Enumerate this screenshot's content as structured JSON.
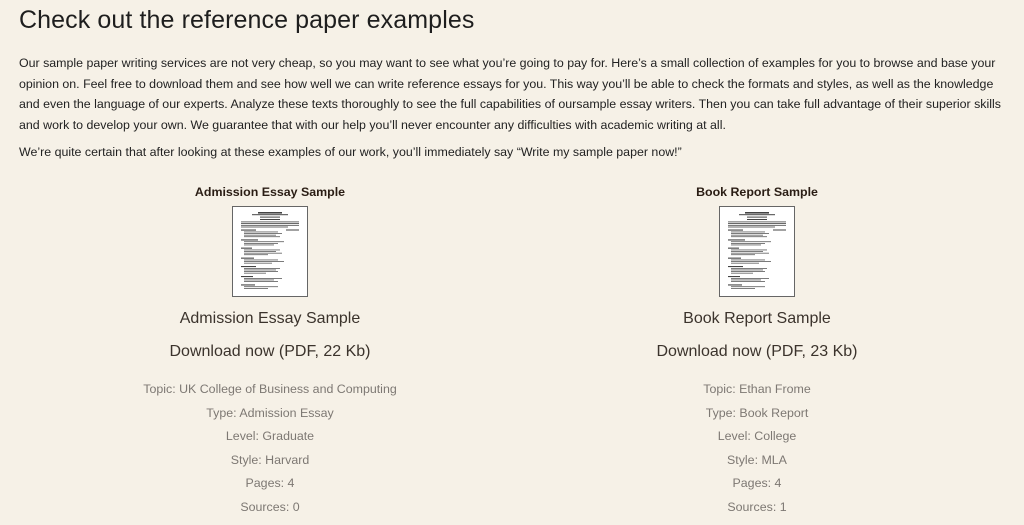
{
  "page": {
    "title": "Check out the reference paper examples",
    "intro": "Our sample paper writing services are not very cheap, so you may want to see what you’re going to pay for. Here’s a small collection of examples for you to browse and base your opinion on. Feel free to download them and see how well we can write reference essays for you. This way you’ll be able to check the formats and styles, as well as the knowledge and even the language of our experts. Analyze these texts thoroughly to see the full capabilities of oursample essay writers. Then you can take full advantage of their superior skills and work to develop your own. We guarantee that with our help you’ll never encounter any difficulties with academic writing at all.",
    "intro2": "We’re quite certain that after looking at these examples of our work, you’ll immediately say “Write my sample paper now!”"
  },
  "samples": [
    {
      "heading": "Admission Essay Sample",
      "title": "Admission Essay Sample",
      "download": "Download now (PDF, 22 Kb)",
      "meta": [
        "Topic: UK College of Business and Computing",
        "Type: Admission Essay",
        "Level: Graduate",
        "Style: Harvard",
        "Pages: 4",
        "Sources: 0"
      ]
    },
    {
      "heading": "Book Report Sample",
      "title": "Book Report Sample",
      "download": "Download now (PDF, 23 Kb)",
      "meta": [
        "Topic: Ethan Frome",
        "Type: Book Report",
        "Level: College",
        "Style: MLA",
        "Pages: 4",
        "Sources: 1"
      ]
    }
  ]
}
